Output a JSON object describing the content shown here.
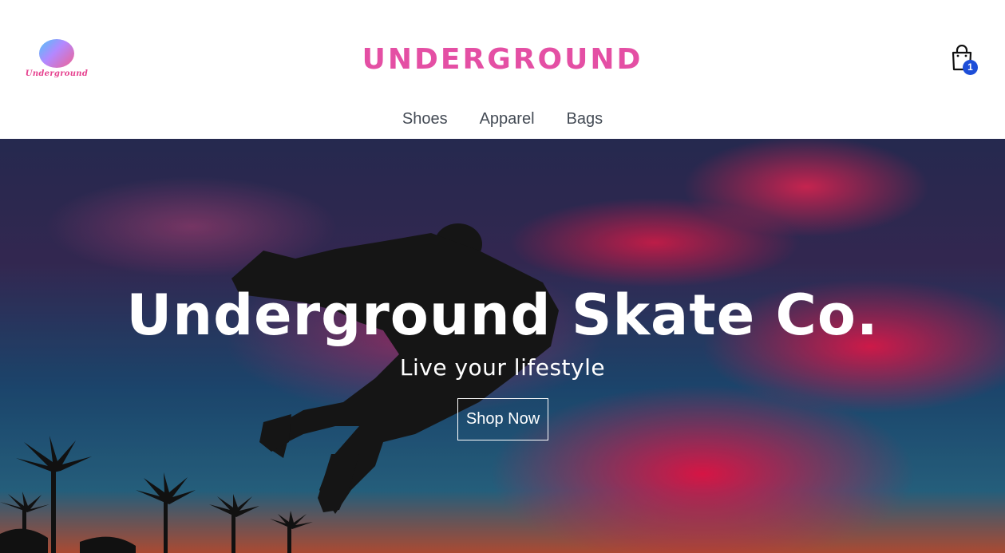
{
  "header": {
    "logo_text": "Underground",
    "brand_title": "UNDERGROUND",
    "cart": {
      "icon": "shopping-bag-icon",
      "count": "1"
    },
    "nav": [
      {
        "label": "Shoes"
      },
      {
        "label": "Apparel"
      },
      {
        "label": "Bags"
      }
    ]
  },
  "hero": {
    "title": "Underground Skate Co.",
    "subtitle": "Live your lifestyle",
    "cta_label": "Shop Now"
  },
  "colors": {
    "brand_pink": "#e44fa4",
    "badge_blue": "#1d4ed8",
    "nav_text": "#444b55"
  }
}
